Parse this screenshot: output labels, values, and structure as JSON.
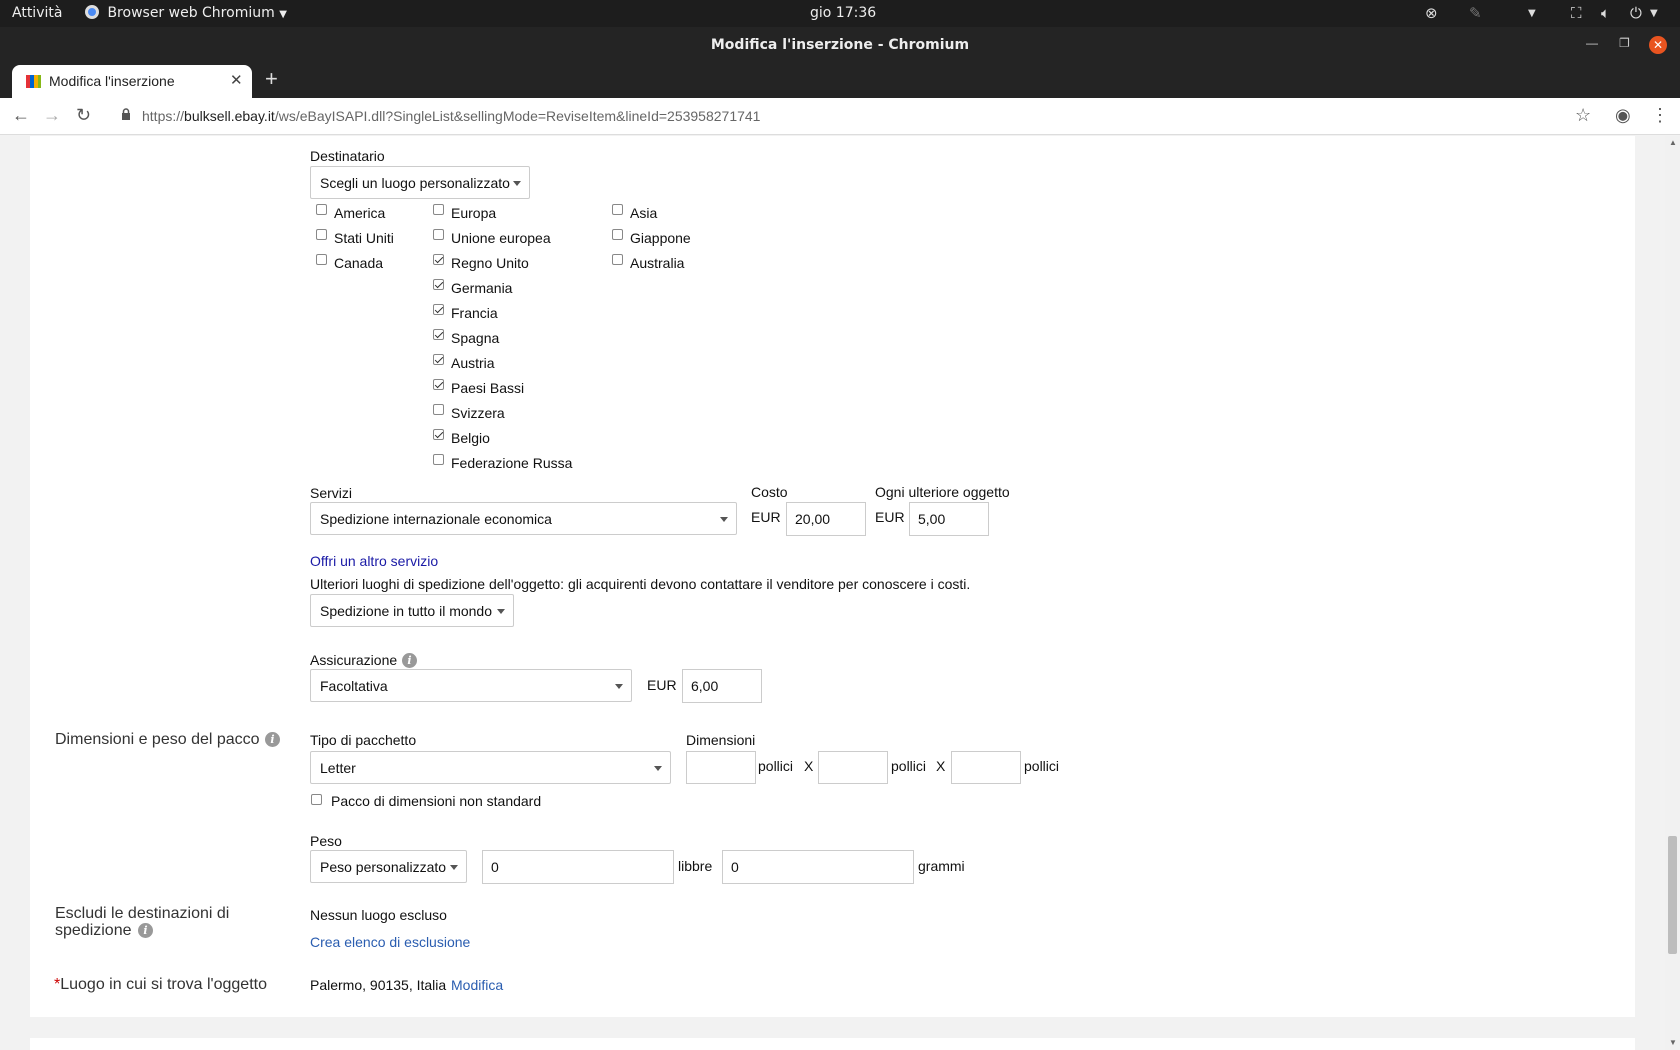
{
  "system_bar": {
    "activities": "Attività",
    "app_name": "Browser web Chromium",
    "clock": "gio 17:36"
  },
  "window": {
    "title": "Modifica l'inserzione - Chromium"
  },
  "tab": {
    "title": "Modifica l'inserzione"
  },
  "address_bar": {
    "url_prefix": "https://",
    "url_host": "bulksell.ebay.it",
    "url_path": "/ws/eBayISAPI.dll?SingleList&sellingMode=ReviseItem&lineId=253958271741"
  },
  "destination": {
    "label": "Destinatario",
    "select_value": "Scegli un luogo personalizzato",
    "col1": [
      {
        "label": "America",
        "checked": false
      },
      {
        "label": "Stati Uniti",
        "checked": false
      },
      {
        "label": "Canada",
        "checked": false
      }
    ],
    "col2": [
      {
        "label": "Europa",
        "checked": false
      },
      {
        "label": "Unione europea",
        "checked": false
      },
      {
        "label": "Regno Unito",
        "checked": true
      },
      {
        "label": "Germania",
        "checked": true
      },
      {
        "label": "Francia",
        "checked": true
      },
      {
        "label": "Spagna",
        "checked": true
      },
      {
        "label": "Austria",
        "checked": true
      },
      {
        "label": "Paesi Bassi",
        "checked": true
      },
      {
        "label": "Svizzera",
        "checked": false
      },
      {
        "label": "Belgio",
        "checked": true
      },
      {
        "label": "Federazione Russa",
        "checked": false
      }
    ],
    "col3": [
      {
        "label": "Asia",
        "checked": false
      },
      {
        "label": "Giappone",
        "checked": false
      },
      {
        "label": "Australia",
        "checked": false
      }
    ]
  },
  "services": {
    "label": "Servizi",
    "select_value": "Spedizione internazionale economica",
    "cost_label": "Costo",
    "cost_currency": "EUR",
    "cost_value": "20,00",
    "additional_label": "Ogni ulteriore oggetto",
    "additional_currency": "EUR",
    "additional_value": "5,00",
    "offer_link": "Offri un altro servizio",
    "other_locations_text": "Ulteriori luoghi di spedizione dell'oggetto: gli acquirenti devono contattare il venditore per conoscere i costi.",
    "other_locations_select": "Spedizione in tutto il mondo"
  },
  "insurance": {
    "label": "Assicurazione",
    "select_value": "Facoltativa",
    "currency": "EUR",
    "value": "6,00"
  },
  "package": {
    "section_label": "Dimensioni e peso del pacco",
    "type_label": "Tipo di pacchetto",
    "type_value": "Letter",
    "dimensions_label": "Dimensioni",
    "unit": "pollici",
    "times": "X",
    "dim1": "",
    "dim2": "",
    "dim3": "",
    "nonstandard_label": "Pacco di dimensioni non standard",
    "weight_label": "Peso",
    "weight_select": "Peso personalizzato",
    "pounds_value": "0",
    "pounds_unit": "libbre",
    "grams_value": "0",
    "grams_unit": "grammi"
  },
  "exclusions": {
    "section_label_line1": "Escludi le destinazioni di",
    "section_label_line2": "spedizione",
    "status": "Nessun luogo escluso",
    "create_link": "Crea elenco di esclusione"
  },
  "location": {
    "required_mark": "*",
    "section_label": "Luogo in cui si trova l'oggetto",
    "value": "Palermo, 90135, Italia",
    "edit_link": "Modifica"
  },
  "colors": {
    "link": "#2a5db0",
    "required": "#cc0000",
    "close_button": "#e95420"
  }
}
